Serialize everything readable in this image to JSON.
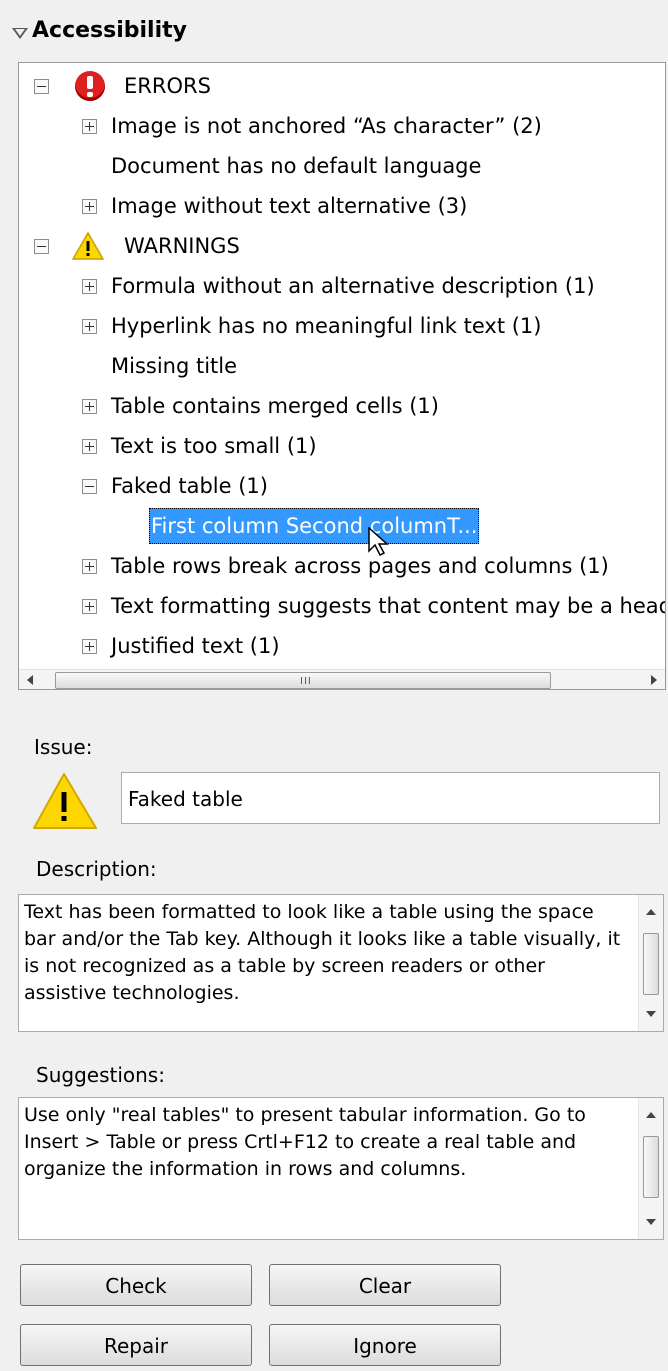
{
  "panel": {
    "title": "Accessibility"
  },
  "tree": {
    "errors_label": "ERRORS",
    "error_items": [
      "Image is not anchored “As character” (2)",
      "Document has no default language",
      "Image without text alternative (3)"
    ],
    "warnings_label": "WARNINGS",
    "warning_items": [
      "Formula without an alternative description (1)",
      "Hyperlink has no meaningful link text (1)",
      "Missing title",
      "Table contains merged cells (1)",
      "Text is too small (1)",
      "Faked table (1)",
      "First column  Second columnT...",
      "Table rows break across pages and columns (1)",
      "Text formatting suggests that content may be a head",
      "Justified text (1)"
    ],
    "scrollbar_grip": "III"
  },
  "issue": {
    "label": "Issue:",
    "value": "Faked table"
  },
  "description": {
    "label": "Description:",
    "text": "Text has been formatted to look like a table using the space bar and/or the Tab key. Although it looks like a table visually, it is not recognized as a table by screen readers or other assistive technologies."
  },
  "suggestions": {
    "label": "Suggestions:",
    "text": "Use only \"real tables\" to present tabular information. Go to Insert > Table or press Crtl+F12 to create a real table and organize the information in rows and columns."
  },
  "buttons": {
    "check": "Check",
    "clear": "Clear",
    "repair": "Repair",
    "ignore": "Ignore"
  },
  "colors": {
    "selection": "#3399ff",
    "error": "#e02020",
    "warning": "#ffd700"
  }
}
